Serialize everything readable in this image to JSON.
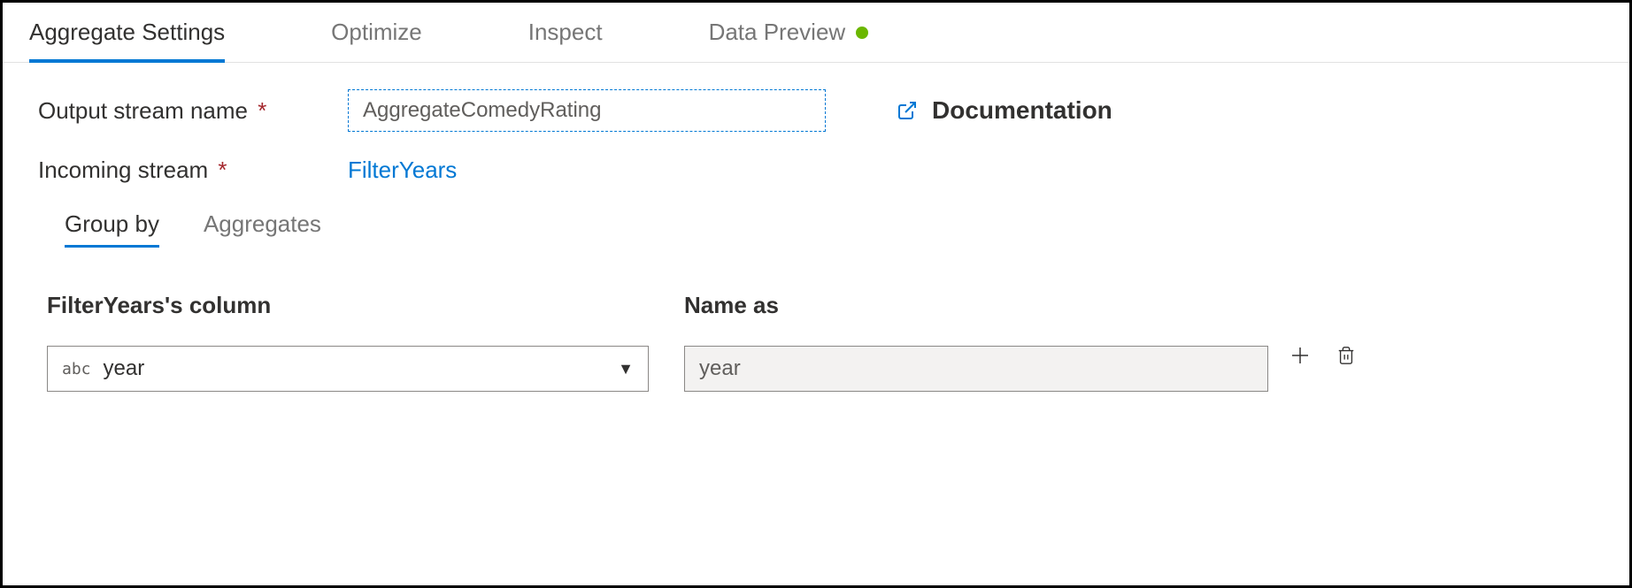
{
  "tabs": {
    "aggregate_settings": "Aggregate Settings",
    "optimize": "Optimize",
    "inspect": "Inspect",
    "data_preview": "Data Preview"
  },
  "form": {
    "output_stream_label": "Output stream name",
    "output_stream_value": "AggregateComedyRating",
    "incoming_stream_label": "Incoming stream",
    "incoming_stream_value": "FilterYears",
    "documentation_label": "Documentation"
  },
  "sub_tabs": {
    "group_by": "Group by",
    "aggregates": "Aggregates"
  },
  "columns": {
    "source_header": "FilterYears's column",
    "name_as_header": "Name as",
    "rows": [
      {
        "type_badge": "abc",
        "source_value": "year",
        "name_as_value": "year"
      }
    ]
  }
}
